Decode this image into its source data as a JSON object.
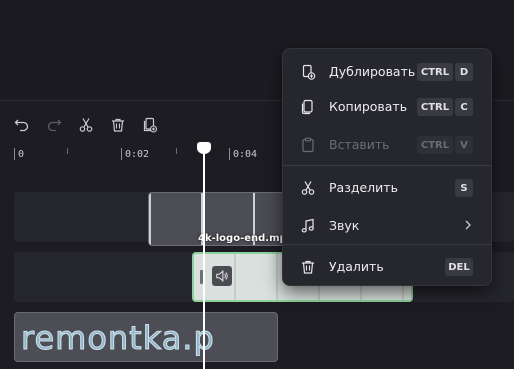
{
  "toolbar": {
    "icons": [
      "undo-icon",
      "redo-icon",
      "cut-icon",
      "trash-icon",
      "duplicate-icon"
    ]
  },
  "ruler": {
    "labels": [
      "0",
      "0:02",
      "0:04"
    ]
  },
  "timeline": {
    "logo_clip_label": "4k-logo-end.mp",
    "text_clip": "remontka.p"
  },
  "context_menu": {
    "duplicate": {
      "label": "Дублировать",
      "key1": "CTRL",
      "key2": "D"
    },
    "copy": {
      "label": "Копировать",
      "key1": "CTRL",
      "key2": "C"
    },
    "paste": {
      "label": "Вставить",
      "key1": "CTRL",
      "key2": "V"
    },
    "split": {
      "label": "Разделить",
      "key1": "S"
    },
    "audio": {
      "label": "Звук"
    },
    "delete": {
      "label": "Удалить",
      "key1": "DEL"
    }
  },
  "colors": {
    "background": "#1c1c22",
    "menu_bg": "#26262d",
    "clip_selected_border": "#8fd19e",
    "playhead": "#ffffff"
  }
}
